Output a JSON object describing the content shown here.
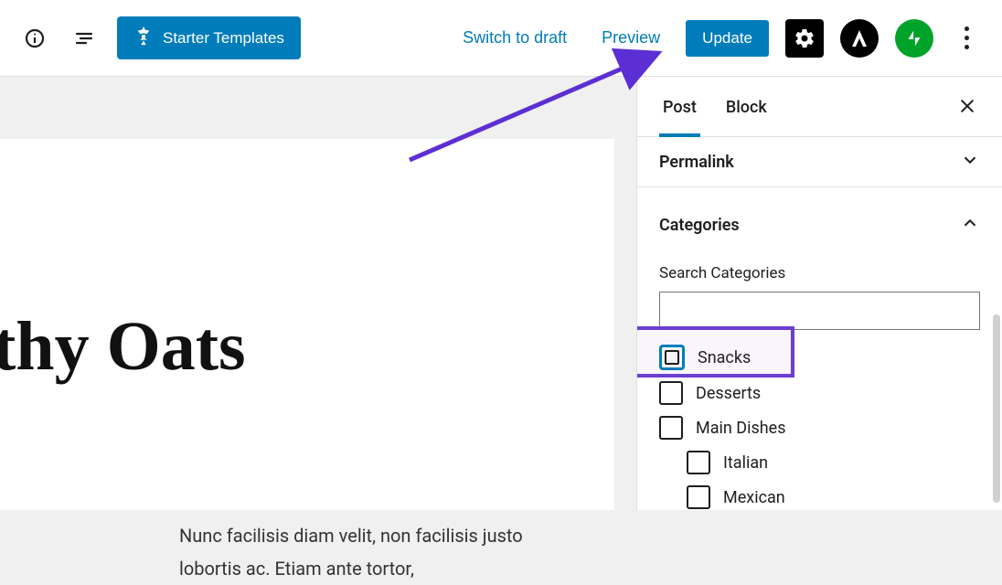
{
  "toolbar": {
    "starter_templates": "Starter Templates",
    "switch_draft": "Switch to draft",
    "preview": "Preview",
    "update": "Update"
  },
  "sidebar": {
    "tabs": {
      "post": "Post",
      "block": "Block"
    },
    "permalink": "Permalink",
    "categories": "Categories",
    "search_label": "Search Categories",
    "search_value": "",
    "cats": [
      {
        "label": "Snacks"
      },
      {
        "label": "Desserts"
      },
      {
        "label": "Main Dishes"
      },
      {
        "label": "Italian",
        "indent": true
      },
      {
        "label": "Mexican",
        "indent": true
      }
    ]
  },
  "post": {
    "title": "thy Oats",
    "body": "Nunc facilisis diam velit, non facilisis justo lobortis ac. Etiam ante tortor,"
  }
}
